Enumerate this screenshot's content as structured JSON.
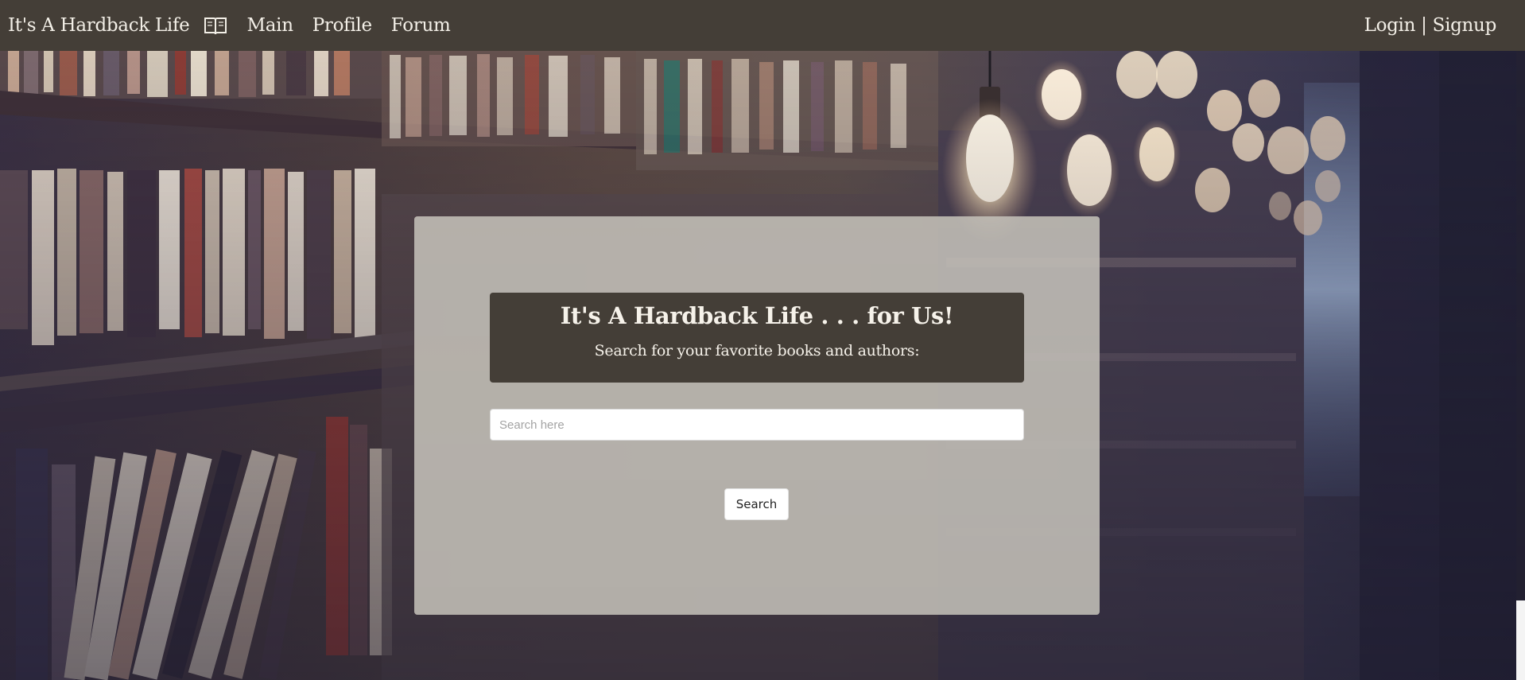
{
  "nav": {
    "brand": "It's A Hardback Life",
    "brand_icon": "open-book-icon",
    "links": [
      "Main",
      "Profile",
      "Forum"
    ],
    "login": "Login",
    "separator": "|",
    "signup": "Signup"
  },
  "hero": {
    "title": "It's A Hardback Life . . . for Us!",
    "subtitle": "Search for your favorite books and authors:"
  },
  "search": {
    "placeholder": "Search here",
    "value": "",
    "button_label": "Search"
  },
  "colors": {
    "navbar": "#443e37",
    "panel": "#c4c0b8",
    "text_light": "#f3efe7"
  }
}
